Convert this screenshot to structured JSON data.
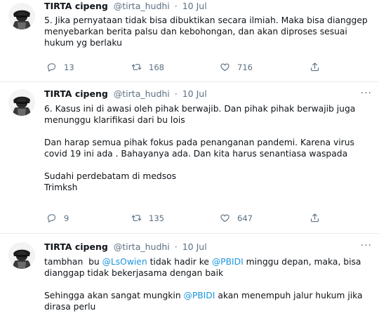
{
  "tweets": [
    {
      "author_name": "TIRTA cipeng",
      "handle": "@tirta_hudhi",
      "separator": "·",
      "date": "10 Jul",
      "lines": [
        "5. Jika pernyataan tidak bisa dibuktikan secara ilmiah. Maka bisa dianggep",
        "menyebarkan berita palsu dan kebohongan, dan akan diproses sesuai",
        "hukum yg berlaku"
      ],
      "replies": "13",
      "retweets": "168",
      "likes": "716"
    },
    {
      "author_name": "TIRTA cipeng",
      "handle": "@tirta_hudhi",
      "separator": "·",
      "date": "10 Jul",
      "lines": [
        "6. Kasus ini di awasi oleh pihak berwajib. Dan pihak pihak berwajib juga",
        "menunggu klarifikasi dari bu lois",
        "Dan harap semua pihak fokus pada penanganan pandemi. Karena virus",
        "covid 19 ini ada . Bahayanya ada. Dan kita harus senantiasa waspada",
        "Sudahi perdebatam di medsos",
        "Trimksh"
      ],
      "replies": "9",
      "retweets": "135",
      "likes": "647"
    },
    {
      "author_name": "TIRTA cipeng",
      "handle": "@tirta_hudhi",
      "separator": "·",
      "date": "10 Jul",
      "line1_a": "tambhan  bu ",
      "mention1": "@LsOwien",
      "line1_b": " tidak hadir ke ",
      "mention2": "@PBIDI",
      "line1_c": " minggu depan, maka, bisa",
      "line2": "dianggap tidak bekerjasama dengan baik",
      "line3_a": "Sehingga akan sangat mungkin ",
      "mention3": "@PBIDI",
      "line3_b": " akan menempuh jalur hukum jika",
      "line4": "dirasa perlu"
    }
  ],
  "more_symbol": "···",
  "icons": {
    "reply": "reply-icon",
    "retweet": "retweet-icon",
    "like": "heart-icon",
    "share": "share-icon"
  },
  "colors": {
    "link": "#1b95e0",
    "muted": "#5b7083",
    "text": "#0f1419",
    "divider": "#e6ecf0"
  }
}
